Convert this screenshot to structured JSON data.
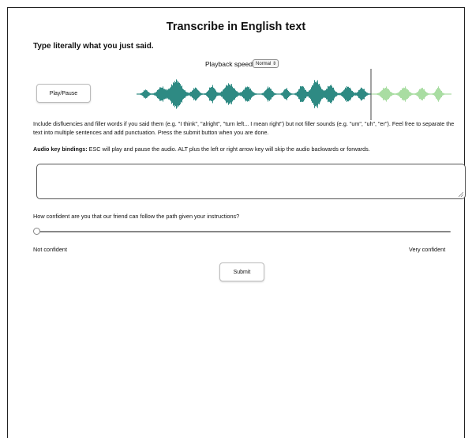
{
  "page": {
    "title": "Transcribe in English text",
    "subtitle": "Type literally what you just said."
  },
  "player": {
    "speed_label": "Playback speed:",
    "speed_value": "Normal",
    "play_pause_label": "Play/Pause",
    "played_color": "#2e8a83",
    "unplayed_color": "#a9dda2",
    "playhead_color": "#444444"
  },
  "instructions": {
    "disfluency_text": "Include disfluencies and filler words if you said them (e.g. \"I think\", \"alright\", \"turn left... I mean right\") but not filler sounds (e.g. \"um\", \"uh\", \"er\"). Feel free to separate the text into multiple sentences and add punctuation. Press the submit button when you are done.",
    "keybindings_label": "Audio key bindings:",
    "keybindings_text": " ESC will play and pause the audio. ALT plus the left or right arrow key will skip the audio backwards or forwards."
  },
  "transcript": {
    "value": "",
    "placeholder": ""
  },
  "confidence": {
    "question": "How confident are you that our friend can follow the path given your instructions?",
    "min_label": "Not confident",
    "max_label": "Very confident",
    "value": 0
  },
  "submit_label": "Submit"
}
